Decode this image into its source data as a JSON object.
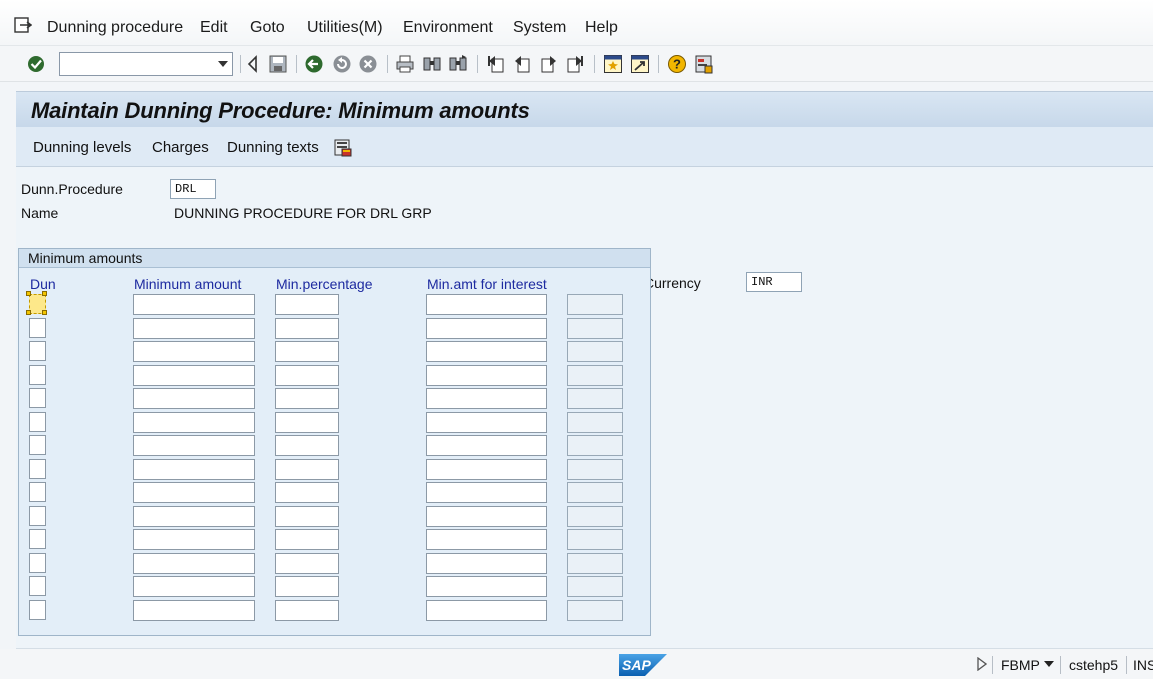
{
  "menu": {
    "items": [
      {
        "label": "Dunning procedure"
      },
      {
        "label": "Edit"
      },
      {
        "label": "Goto"
      },
      {
        "label": "Utilities(M)"
      },
      {
        "label": "Environment"
      },
      {
        "label": "System"
      },
      {
        "label": "Help"
      }
    ]
  },
  "toolbar": {
    "command_value": "",
    "icons": [
      "enter-icon",
      "save-icon",
      "back-icon",
      "exit-icon",
      "cancel-icon",
      "print-icon",
      "find-icon",
      "find-next-icon",
      "first-page-icon",
      "previous-page-icon",
      "next-page-icon",
      "last-page-icon",
      "create-session-icon",
      "shortcut-icon",
      "help-icon",
      "layout-icon"
    ]
  },
  "title": "Maintain Dunning Procedure: Minimum amounts",
  "app_toolbar": {
    "dunning_levels": "Dunning levels",
    "charges": "Charges",
    "dunning_texts": "Dunning texts"
  },
  "header": {
    "procedure_label": "Dunn.Procedure",
    "procedure_value": "DRL",
    "name_label": "Name",
    "name_value": "DUNNING PROCEDURE FOR DRL GRP",
    "currency_label": "Currency",
    "currency_value": "INR"
  },
  "group": {
    "title": "Minimum amounts",
    "columns": [
      "Dun",
      "Minimum amount",
      "Min.percentage",
      "Min.amt for interest"
    ],
    "row_count": 14
  },
  "status": {
    "transaction": "FBMP",
    "server": "cstehp5",
    "mode": "INS"
  },
  "colors": {
    "title_bg": "#c7d8ea",
    "column_header_text": "#1d2aa0",
    "selection": "#fde88a"
  }
}
